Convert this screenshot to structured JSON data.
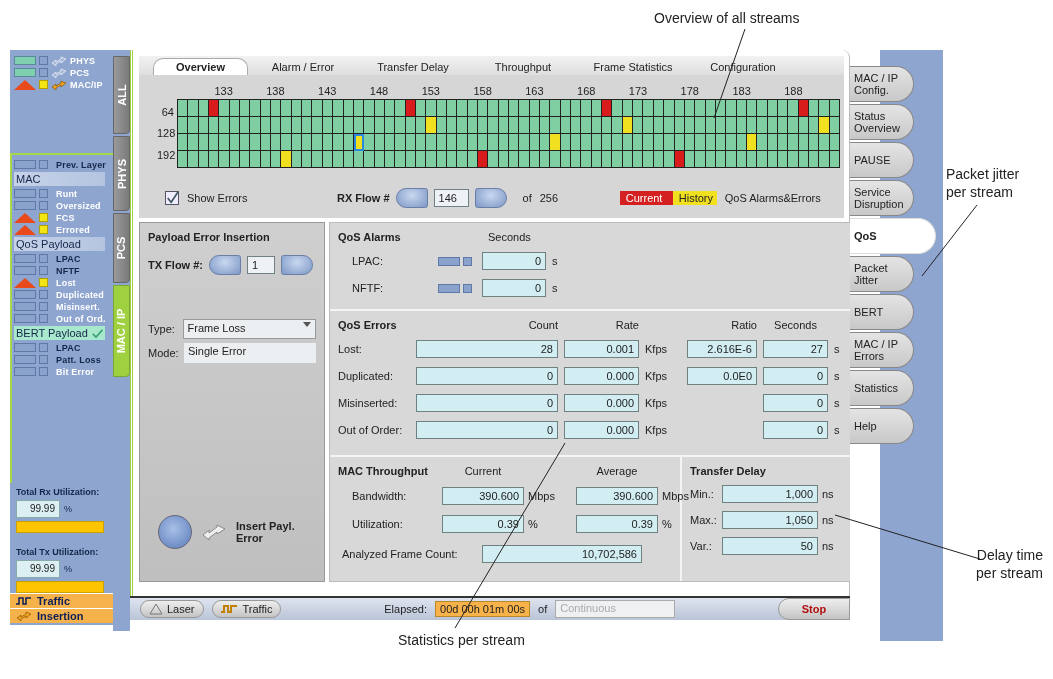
{
  "indicators": [
    {
      "label": "PHYS",
      "active": true,
      "alarm": false,
      "history": false
    },
    {
      "label": "PCS",
      "active": true,
      "alarm": false,
      "history": false
    },
    {
      "label": "MAC/IP",
      "active": true,
      "alarm": true,
      "history": true
    }
  ],
  "alarm_list": [
    {
      "kind": "item",
      "label": "Prev. Layer",
      "alarm": false,
      "history": false,
      "disabled": false
    },
    {
      "kind": "header",
      "label": "MAC",
      "checked": false
    },
    {
      "kind": "item",
      "label": "Runt",
      "alarm": false,
      "history": false,
      "disabled": true
    },
    {
      "kind": "item",
      "label": "Oversized",
      "alarm": false,
      "history": false,
      "disabled": true
    },
    {
      "kind": "item",
      "label": "FCS",
      "alarm": true,
      "history": true,
      "disabled": true
    },
    {
      "kind": "item",
      "label": "Errored",
      "alarm": true,
      "history": true,
      "disabled": true
    },
    {
      "kind": "header",
      "label": "QoS Payload",
      "checked": false
    },
    {
      "kind": "item",
      "label": "LPAC",
      "alarm": false,
      "history": false,
      "disabled": false
    },
    {
      "kind": "item",
      "label": "NFTF",
      "alarm": false,
      "history": false,
      "disabled": false
    },
    {
      "kind": "item",
      "label": "Lost",
      "alarm": true,
      "history": true,
      "disabled": true
    },
    {
      "kind": "item",
      "label": "Duplicated",
      "alarm": false,
      "history": false,
      "disabled": true
    },
    {
      "kind": "item",
      "label": "Misinsert.",
      "alarm": false,
      "history": false,
      "disabled": true
    },
    {
      "kind": "item",
      "label": "Out of Ord.",
      "alarm": false,
      "history": false,
      "disabled": true
    },
    {
      "kind": "header",
      "label": "BERT Payload",
      "checked": true
    },
    {
      "kind": "item",
      "label": "LPAC",
      "alarm": false,
      "history": false,
      "disabled": false
    },
    {
      "kind": "item",
      "label": "Patt. Loss",
      "alarm": false,
      "history": false,
      "disabled": false
    },
    {
      "kind": "item",
      "label": "Bit Error",
      "alarm": false,
      "history": false,
      "disabled": true
    }
  ],
  "utilization": [
    {
      "label": "Total Rx Utilization:",
      "value": "99.99",
      "unit": "%",
      "level": 1
    },
    {
      "label": "Total Tx Utilization:",
      "value": "99.99",
      "unit": "%",
      "level": 1
    }
  ],
  "status_badges": [
    {
      "label": "Traffic",
      "kind": "traffic"
    },
    {
      "label": "Insertion",
      "kind": "insertion"
    }
  ],
  "layer_tabs": [
    {
      "label": "ALL",
      "selected": false
    },
    {
      "label": "PHYS",
      "selected": false
    },
    {
      "label": "PCS",
      "selected": false
    },
    {
      "label": "MAC / IP",
      "selected": true
    }
  ],
  "view_tabs": [
    {
      "label": "Overview",
      "selected": true
    },
    {
      "label": "Alarm / Error",
      "selected": false
    },
    {
      "label": "Transfer Delay",
      "selected": false
    },
    {
      "label": "Throughput",
      "selected": false
    },
    {
      "label": "Frame Statistics",
      "selected": false
    },
    {
      "label": "Configuration",
      "selected": false
    }
  ],
  "flow_grid": {
    "column_labels": [
      "133",
      "138",
      "143",
      "148",
      "153",
      "158",
      "163",
      "168",
      "173",
      "178",
      "183",
      "188"
    ],
    "rows": [
      {
        "current": [
          false,
          false,
          false,
          true,
          false,
          false,
          false,
          false,
          false,
          false,
          false,
          false,
          false,
          false,
          false,
          false,
          false,
          false,
          false,
          false,
          false,
          false,
          true,
          false,
          false,
          false,
          false,
          false,
          false,
          false,
          false,
          false,
          false,
          false,
          false,
          false,
          false,
          false,
          false,
          false,
          false,
          true,
          false,
          false,
          false,
          false,
          false,
          false,
          false,
          false,
          false,
          false,
          false,
          false,
          false,
          false,
          false,
          false,
          false,
          false,
          true,
          false,
          false,
          false
        ],
        "history": [
          false,
          false,
          false,
          false,
          false,
          false,
          false,
          false,
          false,
          false,
          false,
          false,
          false,
          false,
          false,
          false,
          false,
          false,
          false,
          false,
          false,
          false,
          false,
          false,
          false,
          false,
          false,
          false,
          false,
          false,
          false,
          false,
          false,
          false,
          false,
          false,
          false,
          false,
          false,
          false,
          false,
          false,
          false,
          false,
          false,
          false,
          false,
          false,
          false,
          false,
          false,
          false,
          false,
          false,
          false,
          false,
          false,
          false,
          false,
          false,
          false,
          false,
          false,
          false
        ],
        "selected": [
          false,
          false,
          false,
          false,
          false,
          false,
          false,
          false,
          false,
          false,
          false,
          false,
          false,
          false,
          false,
          false,
          false,
          false,
          false,
          false,
          false,
          false,
          false,
          false,
          false,
          false,
          false,
          false,
          false,
          false,
          false,
          false,
          false,
          false,
          false,
          false,
          false,
          false,
          false,
          false,
          false,
          false,
          false,
          false,
          false,
          false,
          false,
          false,
          false,
          false,
          false,
          false,
          false,
          false,
          false,
          false,
          false,
          false,
          false,
          false,
          false,
          false,
          false,
          false
        ]
      },
      {
        "label": "64",
        "current": [
          false,
          false,
          false,
          false,
          false,
          false,
          false,
          false,
          false,
          false,
          false,
          false,
          false,
          false,
          false,
          false,
          false,
          false,
          false,
          false,
          false,
          false,
          false,
          false,
          false,
          false,
          false,
          false,
          false,
          false,
          false,
          false,
          false,
          false,
          false,
          false,
          false,
          false,
          false,
          false,
          false,
          false,
          false,
          false,
          false,
          false,
          false,
          false,
          false,
          false,
          false,
          false,
          false,
          false,
          false,
          false,
          false,
          false,
          false,
          false,
          false,
          false,
          false,
          false
        ],
        "history": [
          false,
          false,
          false,
          false,
          false,
          false,
          false,
          false,
          false,
          false,
          false,
          false,
          false,
          false,
          false,
          false,
          false,
          false,
          false,
          false,
          false,
          false,
          false,
          false,
          true,
          false,
          false,
          false,
          false,
          false,
          false,
          false,
          false,
          false,
          false,
          false,
          false,
          false,
          false,
          false,
          false,
          false,
          false,
          true,
          false,
          false,
          false,
          false,
          false,
          false,
          false,
          false,
          false,
          false,
          false,
          false,
          false,
          false,
          false,
          false,
          false,
          false,
          true,
          false
        ],
        "selected": [
          false,
          false,
          false,
          false,
          false,
          false,
          false,
          false,
          false,
          false,
          false,
          false,
          false,
          false,
          false,
          false,
          false,
          false,
          false,
          false,
          false,
          false,
          false,
          false,
          false,
          false,
          false,
          false,
          false,
          false,
          false,
          false,
          false,
          false,
          false,
          false,
          false,
          false,
          false,
          false,
          false,
          false,
          false,
          false,
          false,
          false,
          false,
          false,
          false,
          false,
          false,
          false,
          false,
          false,
          false,
          false,
          false,
          false,
          false,
          false,
          false,
          false,
          false,
          false
        ]
      },
      {
        "label": "128",
        "current": [
          false,
          false,
          false,
          false,
          false,
          false,
          false,
          false,
          false,
          false,
          false,
          false,
          false,
          false,
          false,
          false,
          false,
          false,
          false,
          false,
          false,
          false,
          false,
          false,
          false,
          false,
          false,
          false,
          false,
          false,
          false,
          false,
          false,
          false,
          false,
          false,
          false,
          false,
          false,
          false,
          false,
          false,
          false,
          false,
          false,
          false,
          false,
          false,
          false,
          false,
          false,
          false,
          false,
          false,
          false,
          false,
          false,
          false,
          false,
          false,
          false,
          false,
          false,
          false
        ],
        "history": [
          false,
          false,
          false,
          false,
          false,
          false,
          false,
          false,
          false,
          false,
          false,
          false,
          false,
          false,
          false,
          false,
          false,
          true,
          false,
          false,
          false,
          false,
          false,
          false,
          false,
          false,
          false,
          false,
          false,
          false,
          false,
          false,
          false,
          false,
          false,
          false,
          true,
          false,
          false,
          false,
          false,
          false,
          false,
          false,
          false,
          false,
          false,
          false,
          false,
          false,
          false,
          false,
          false,
          false,
          false,
          true,
          false,
          false,
          false,
          false,
          false,
          false,
          false,
          false
        ],
        "selected": [
          false,
          false,
          false,
          false,
          false,
          false,
          false,
          false,
          false,
          false,
          false,
          false,
          false,
          false,
          false,
          false,
          false,
          true,
          false,
          false,
          false,
          false,
          false,
          false,
          false,
          false,
          false,
          false,
          false,
          false,
          false,
          false,
          false,
          false,
          false,
          false,
          false,
          false,
          false,
          false,
          false,
          false,
          false,
          false,
          false,
          false,
          false,
          false,
          false,
          false,
          false,
          false,
          false,
          false,
          false,
          false,
          false,
          false,
          false,
          false,
          false,
          false,
          false,
          false
        ]
      },
      {
        "label": "192",
        "current": [
          false,
          false,
          false,
          false,
          false,
          false,
          false,
          false,
          false,
          false,
          false,
          false,
          false,
          false,
          false,
          false,
          false,
          false,
          false,
          false,
          false,
          false,
          false,
          false,
          false,
          false,
          false,
          false,
          false,
          true,
          false,
          false,
          false,
          false,
          false,
          false,
          false,
          false,
          false,
          false,
          false,
          false,
          false,
          false,
          false,
          false,
          false,
          false,
          true,
          false,
          false,
          false,
          false,
          false,
          false,
          false,
          false,
          false,
          false,
          false,
          false,
          false,
          false,
          false
        ],
        "history": [
          false,
          false,
          false,
          false,
          false,
          false,
          false,
          false,
          false,
          false,
          true,
          false,
          false,
          false,
          false,
          false,
          false,
          false,
          false,
          false,
          false,
          false,
          false,
          false,
          false,
          false,
          false,
          false,
          false,
          false,
          false,
          false,
          false,
          false,
          false,
          false,
          false,
          false,
          false,
          false,
          false,
          false,
          false,
          false,
          false,
          false,
          false,
          false,
          false,
          false,
          false,
          false,
          false,
          false,
          false,
          false,
          false,
          false,
          false,
          false,
          false,
          false,
          false,
          false
        ],
        "selected": [
          false,
          false,
          false,
          false,
          false,
          false,
          false,
          false,
          false,
          false,
          false,
          false,
          false,
          false,
          false,
          false,
          false,
          false,
          false,
          false,
          false,
          false,
          false,
          false,
          false,
          false,
          false,
          false,
          false,
          false,
          false,
          false,
          false,
          false,
          false,
          false,
          false,
          false,
          false,
          false,
          false,
          false,
          false,
          false,
          false,
          false,
          false,
          false,
          false,
          false,
          false,
          false,
          false,
          false,
          false,
          false,
          false,
          false,
          false,
          false,
          false,
          false,
          false,
          false
        ]
      }
    ]
  },
  "show_errors": {
    "label": "Show Errors",
    "checked": true
  },
  "rx_flow": {
    "label": "RX Flow #",
    "value": "146",
    "of_label": "of",
    "total": "256"
  },
  "legend": {
    "items": [
      {
        "label": "Current",
        "color": "#d42020"
      },
      {
        "label": "History",
        "color": "#f0e020"
      }
    ],
    "title": "QoS Alarms&Errors"
  },
  "payload_insertion": {
    "title": "Payload Error Insertion",
    "tx_flow": {
      "label": "TX Flow #:",
      "value": "1"
    },
    "type": {
      "label": "Type:",
      "value": "Frame Loss"
    },
    "mode": {
      "label": "Mode:",
      "value": "Single Error"
    },
    "insert_label": "Insert Payl. Error"
  },
  "qos_alarms": {
    "title": "QoS Alarms",
    "seconds_header": "Seconds",
    "rows": [
      {
        "label": "LPAC:",
        "alarm": false,
        "history": false,
        "seconds": "0",
        "unit": "s"
      },
      {
        "label": "NFTF:",
        "alarm": false,
        "history": false,
        "seconds": "0",
        "unit": "s"
      }
    ]
  },
  "qos_errors": {
    "title": "QoS Errors",
    "columns": [
      "Count",
      "Rate",
      "Ratio",
      "Seconds"
    ],
    "rows": [
      {
        "label": "Lost:",
        "count": "28",
        "rate": "0.001",
        "rate_unit": "Kfps",
        "ratio": "2.616E-6",
        "seconds": "27",
        "seconds_unit": "s"
      },
      {
        "label": "Duplicated:",
        "count": "0",
        "rate": "0.000",
        "rate_unit": "Kfps",
        "ratio": "0.0E0",
        "seconds": "0",
        "seconds_unit": "s"
      },
      {
        "label": "Misinserted:",
        "count": "0",
        "rate": "0.000",
        "rate_unit": "Kfps",
        "seconds": "0",
        "seconds_unit": "s"
      },
      {
        "label": "Out of Order:",
        "count": "0",
        "rate": "0.000",
        "rate_unit": "Kfps",
        "seconds": "0",
        "seconds_unit": "s"
      }
    ]
  },
  "mac_throughput": {
    "title": "MAC Throughput",
    "columns": [
      "Current",
      "Average"
    ],
    "rows": [
      {
        "label": "Bandwidth:",
        "current": "390.600",
        "current_unit": "Mbps",
        "average": "390.600",
        "average_unit": "Mbps"
      },
      {
        "label": "Utilization:",
        "current": "0.39",
        "current_unit": "%",
        "average": "0.39",
        "average_unit": "%"
      }
    ],
    "frame_count": {
      "label": "Analyzed Frame Count:",
      "value": "10,702,586"
    }
  },
  "transfer_delay": {
    "title": "Transfer Delay",
    "rows": [
      {
        "label": "Min.:",
        "value": "1,000",
        "unit": "ns"
      },
      {
        "label": "Max.:",
        "value": "1,050",
        "unit": "ns"
      },
      {
        "label": "Var.:",
        "value": "50",
        "unit": "ns"
      }
    ]
  },
  "side_tabs": [
    {
      "label": "MAC / IP Config.",
      "selected": false
    },
    {
      "label": "Status Overview",
      "selected": false
    },
    {
      "label": "PAUSE",
      "selected": false
    },
    {
      "label": "Service Disruption",
      "selected": false
    },
    {
      "label": "QoS",
      "selected": true
    },
    {
      "label": "Packet Jitter",
      "selected": false
    },
    {
      "label": "BERT",
      "selected": false
    },
    {
      "label": "MAC / IP Errors",
      "selected": false
    },
    {
      "label": "Statistics",
      "selected": false
    },
    {
      "label": "Help",
      "selected": false
    }
  ],
  "bottom_bar": {
    "buttons": [
      {
        "label": "Laser",
        "kind": "laser"
      },
      {
        "label": "Traffic",
        "kind": "traffic"
      }
    ],
    "elapsed_label": "Elapsed:",
    "elapsed": "00d 00h 01m 00s",
    "of_label": "of",
    "duration": "Continuous",
    "stop": "Stop"
  },
  "callouts": [
    {
      "text": "Overview of all streams"
    },
    {
      "text": "Packet jitter per stream"
    },
    {
      "text": "Delay time per stream"
    },
    {
      "text": "Statistics per stream"
    }
  ]
}
